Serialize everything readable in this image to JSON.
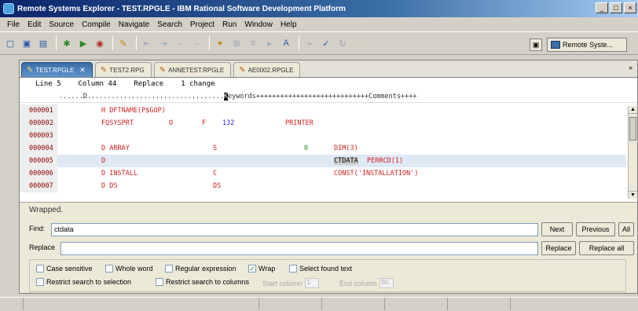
{
  "window": {
    "title": "Remote Systems Explorer - TEST.RPGLE - IBM Rational Software Development Platform",
    "minimize": "_",
    "maximize": "□",
    "close": "×"
  },
  "menu": [
    "File",
    "Edit",
    "Source",
    "Compile",
    "Navigate",
    "Search",
    "Project",
    "Run",
    "Window",
    "Help"
  ],
  "toolbar": {
    "perspective_label": "Remote Syste..."
  },
  "tabs": [
    {
      "label": "TEST.RPGLE",
      "active": true
    },
    {
      "label": "TEST2.RPG",
      "active": false
    },
    {
      "label": "ANNETEST.RPGLE",
      "active": false
    },
    {
      "label": "AE0002.RPGLE",
      "active": false
    }
  ],
  "tab_overflow": "»",
  "editor_status": {
    "line": "Line 5",
    "column": "Column 44",
    "mode": "Replace",
    "changes": "1 change"
  },
  "ruler": {
    "before": "......D..................................",
    "cursor": "K",
    "after": "eywords++++++++++++++++++++++++++++Comments++++"
  },
  "code_lines": [
    {
      "seq": "000001",
      "spec": "H DFTNAME(P$GOP)"
    },
    {
      "seq": "000002",
      "spec": "FQSYSPRT",
      "type": "O",
      "format": "F",
      "length": "132",
      "device": "PRINTER"
    },
    {
      "seq": "000003"
    },
    {
      "seq": "000004",
      "spec": "D ARRAY",
      "dtype": "S",
      "dec": "0",
      "keyword": "DIM(3)"
    },
    {
      "seq": "000005",
      "spec": "D",
      "keyword": "CTDATA",
      "keyword2": "PERRCD(1)"
    },
    {
      "seq": "000006",
      "spec": "D INSTALL",
      "dtype": "C",
      "keyword": "CONST('INSTALLATION')"
    },
    {
      "seq": "000007",
      "spec": "D DS",
      "dtype": "DS"
    }
  ],
  "find": {
    "status": "Wrapped.",
    "find_label": "Find:",
    "find_value": "ctdata",
    "replace_label": "Replace",
    "replace_value": "",
    "next": "Next",
    "previous": "Previous",
    "all": "All",
    "replace_btn": "Replace",
    "replace_all": "Replace all",
    "options": {
      "case_sensitive": "Case sensitive",
      "whole_word": "Whole word",
      "regex": "Regular expression",
      "wrap": "Wrap",
      "select_found": "Select found text",
      "restrict_selection": "Restrict search to selection",
      "restrict_columns": "Restrict search to columns",
      "start_column": "Start column",
      "start_value": "1",
      "end_column": "End column",
      "end_value": "80"
    }
  }
}
